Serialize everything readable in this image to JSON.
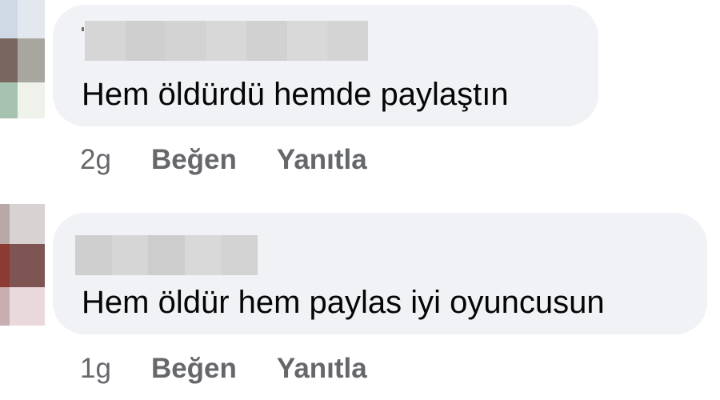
{
  "comments": [
    {
      "text": "Hem öldürdü hemde paylaştın",
      "time": "2g",
      "like_label": "Beğen",
      "reply_label": "Yanıtla"
    },
    {
      "text": "Hem öldür hem paylas iyi oyuncusun",
      "time": "1g",
      "like_label": "Beğen",
      "reply_label": "Yanıtla"
    }
  ],
  "colors": {
    "bubble_bg": "#f0f2f5",
    "text": "#050505",
    "secondary_text": "#65676b"
  }
}
